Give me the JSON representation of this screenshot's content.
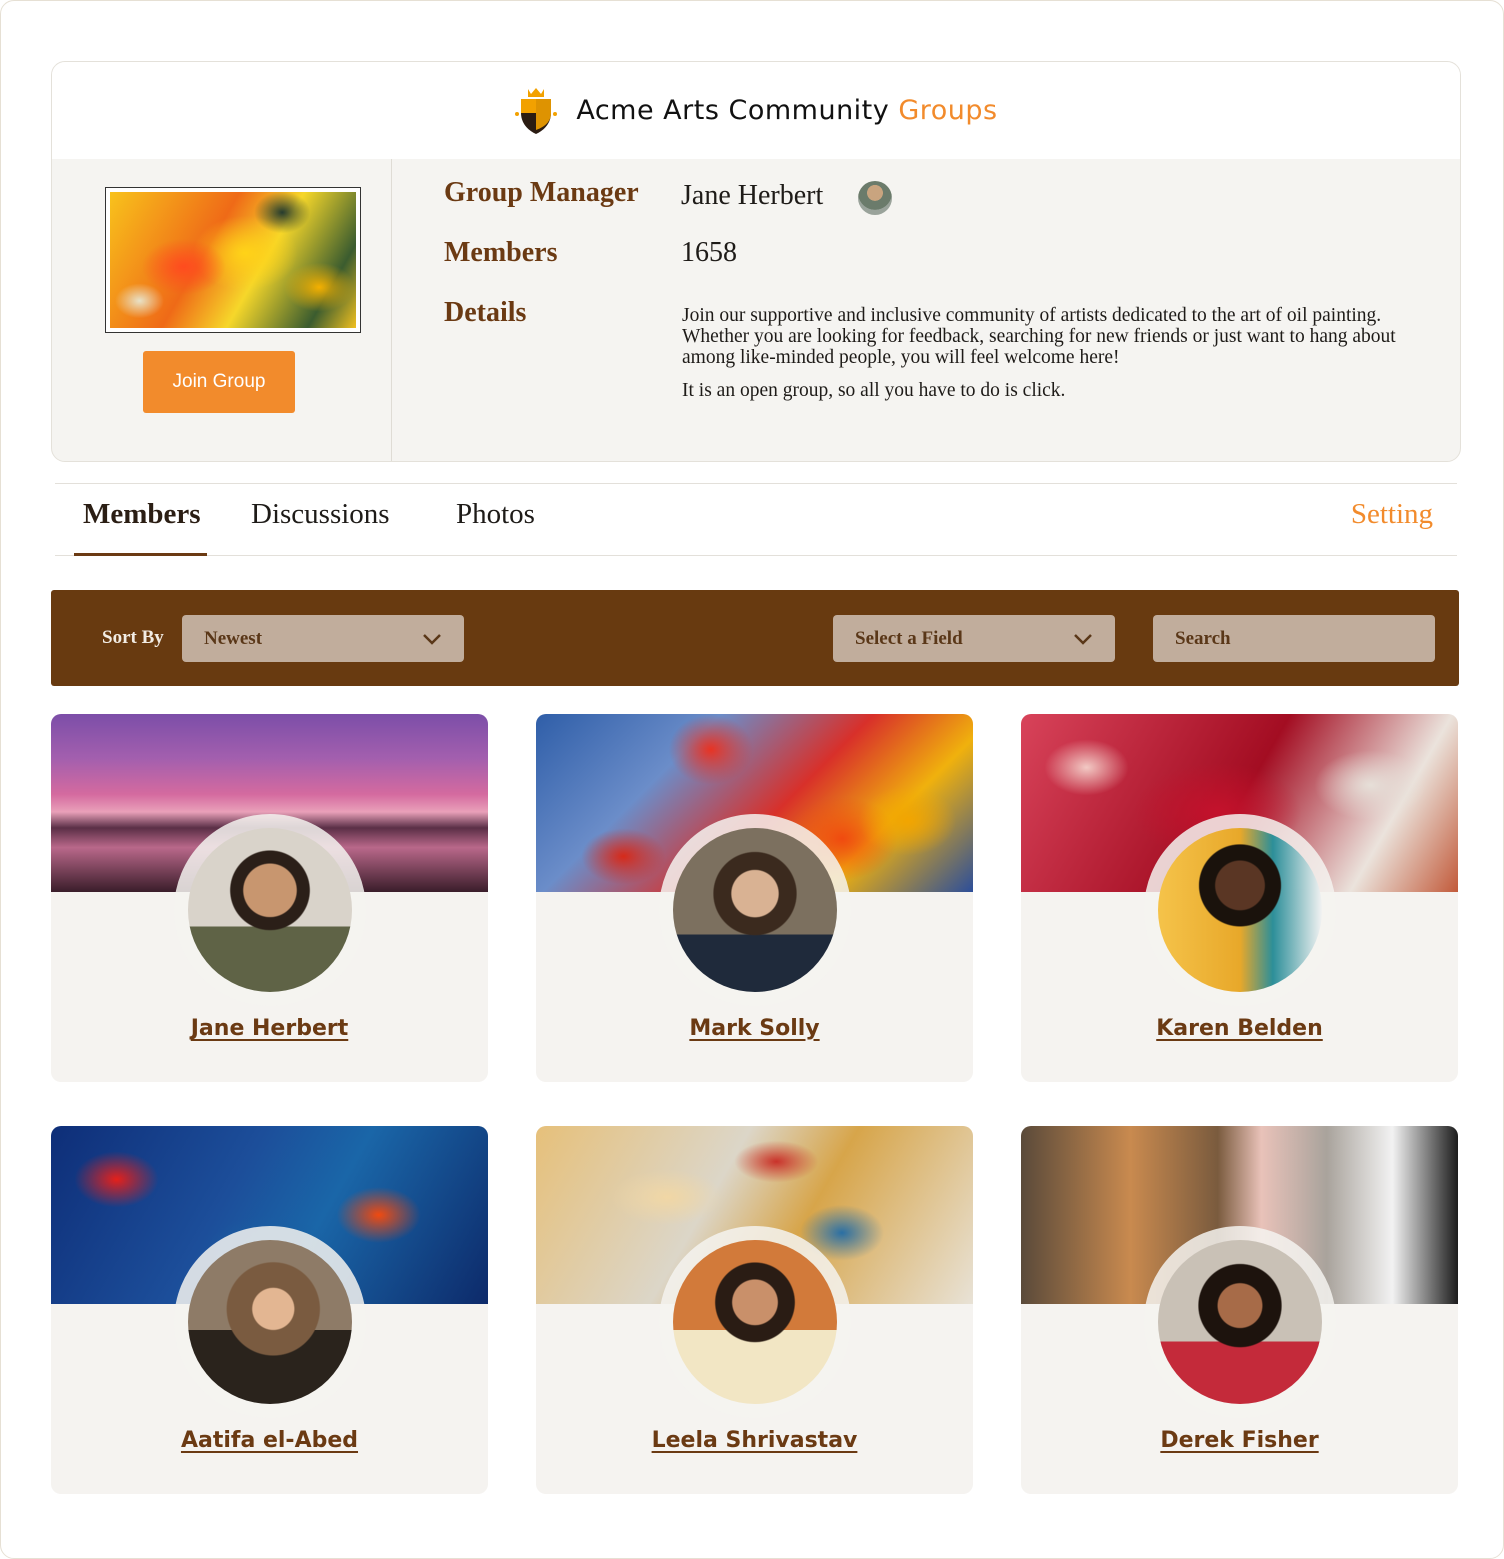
{
  "brand": {
    "title": "Acme Arts Community",
    "accent": "Groups",
    "logo_icon": "shield-crown-icon"
  },
  "group": {
    "join_label": "Join Group",
    "manager_label": "Group Manager",
    "manager_name": "Jane Herbert",
    "members_label": "Members",
    "members_count": "1658",
    "details_label": "Details",
    "details_p1": "Join our supportive and inclusive community of artists dedicated to the art of oil painting. Whether you are looking for feedback, searching for new friends or just want to hang about among like-minded people, you will feel welcome here!",
    "details_p2": "It is an open group, so all you have to do is click."
  },
  "tabs": [
    {
      "label": "Members",
      "active": true
    },
    {
      "label": "Discussions",
      "active": false
    },
    {
      "label": "Photos",
      "active": false
    }
  ],
  "setting_label": "Setting",
  "filters": {
    "sort_label": "Sort By",
    "sort_value": "Newest",
    "field_value": "Select a Field",
    "search_placeholder": "Search"
  },
  "members": [
    {
      "name": "Jane Herbert"
    },
    {
      "name": "Mark Solly"
    },
    {
      "name": "Karen Belden"
    },
    {
      "name": "Aatifa el-Abed"
    },
    {
      "name": "Leela Shrivastav"
    },
    {
      "name": "Derek Fisher"
    }
  ],
  "colors": {
    "accent": "#f28b2c",
    "brown": "#683a10",
    "label_brown": "#6b3a13",
    "field_bg": "#c1ad9c"
  }
}
